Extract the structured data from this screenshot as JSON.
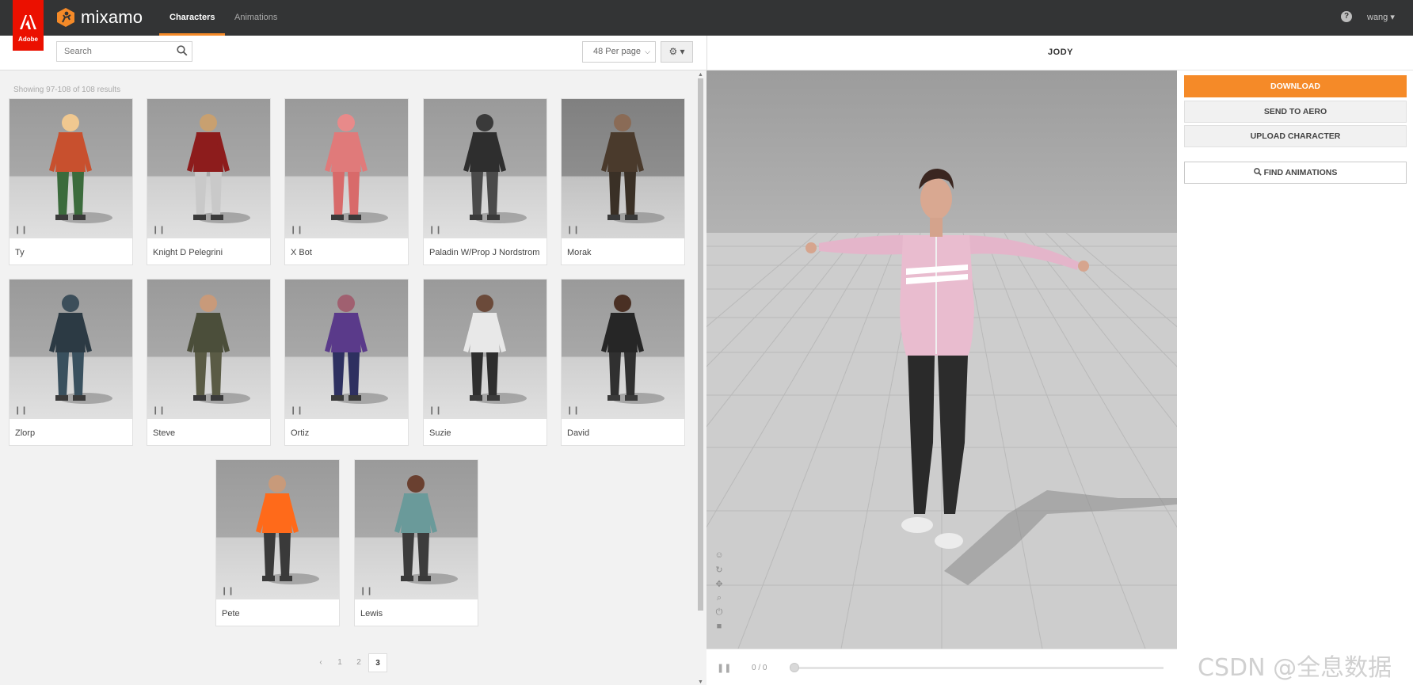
{
  "brand": {
    "adobe_text": "Adobe",
    "name": "mixamo"
  },
  "nav": {
    "tabs": [
      {
        "label": "Characters",
        "active": true
      },
      {
        "label": "Animations",
        "active": false
      }
    ]
  },
  "header": {
    "help_icon": "?",
    "user": "wang ▾"
  },
  "toolbar": {
    "search_placeholder": "Search",
    "per_page": "48 Per page",
    "gear_label": "⚙ ▾"
  },
  "results": {
    "text": "Showing 97-108 of 108 results"
  },
  "characters": [
    {
      "name": "Ty",
      "selected": false
    },
    {
      "name": "Knight D Pelegrini",
      "selected": false
    },
    {
      "name": "X Bot",
      "selected": false
    },
    {
      "name": "Paladin W/Prop J Nordstrom",
      "selected": false
    },
    {
      "name": "Morak",
      "selected": true
    },
    {
      "name": "Zlorp",
      "selected": false
    },
    {
      "name": "Steve",
      "selected": false
    },
    {
      "name": "Ortiz",
      "selected": false
    },
    {
      "name": "Suzie",
      "selected": false
    },
    {
      "name": "David",
      "selected": false
    },
    {
      "name": "Pete",
      "selected": false
    },
    {
      "name": "Lewis",
      "selected": false
    }
  ],
  "pagination": {
    "prev": "‹",
    "pages": [
      "1",
      "2",
      "3"
    ],
    "current": "3"
  },
  "viewer": {
    "title": "JODY",
    "frame_counter": "0 / 0"
  },
  "actions": {
    "download": "DOWNLOAD",
    "send_to_aero": "SEND TO AERO",
    "upload_character": "UPLOAD CHARACTER",
    "find_animations": "FIND ANIMATIONS"
  },
  "watermark": "CSDN @全息数据",
  "colors": {
    "accent": "#f58a28",
    "topbar": "#333435",
    "adobe_red": "#eb1000"
  }
}
